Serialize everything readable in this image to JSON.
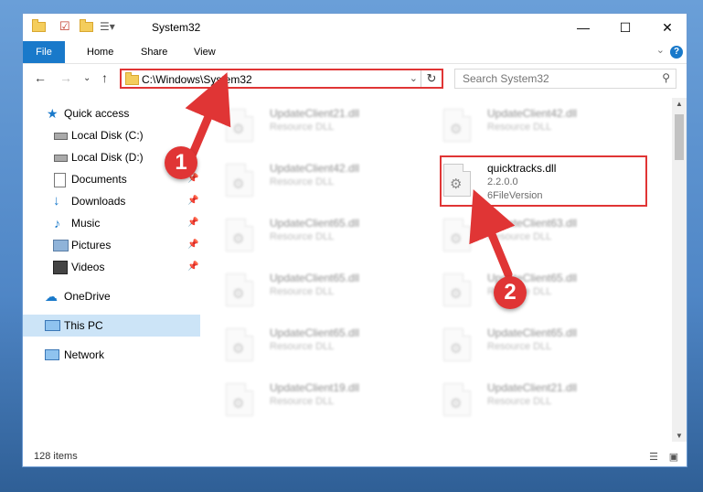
{
  "window": {
    "title": "System32"
  },
  "ribbon": {
    "tabs": [
      {
        "id": "file",
        "label": "File"
      },
      {
        "id": "home",
        "label": "Home"
      },
      {
        "id": "share",
        "label": "Share"
      },
      {
        "id": "view",
        "label": "View"
      }
    ],
    "help_label": "?"
  },
  "address": {
    "path": "C:\\Windows\\System32",
    "search_placeholder": "Search System32"
  },
  "sidebar": {
    "items": [
      {
        "label": "Quick access",
        "icon": "star-icon",
        "pinned": false
      },
      {
        "label": "Local Disk (C:)",
        "icon": "drive-icon",
        "pinned": false
      },
      {
        "label": "Local Disk (D:)",
        "icon": "drive-icon",
        "pinned": false
      },
      {
        "label": "Documents",
        "icon": "documents-icon",
        "pinned": true
      },
      {
        "label": "Downloads",
        "icon": "download-icon",
        "pinned": true
      },
      {
        "label": "Music",
        "icon": "music-icon",
        "pinned": true
      },
      {
        "label": "Pictures",
        "icon": "pictures-icon",
        "pinned": true
      },
      {
        "label": "Videos",
        "icon": "videos-icon",
        "pinned": true
      },
      {
        "label": "OneDrive",
        "icon": "cloud-icon",
        "pinned": false
      },
      {
        "label": "This PC",
        "icon": "computer-icon",
        "pinned": false,
        "selected": true
      },
      {
        "label": "Network",
        "icon": "network-icon",
        "pinned": false
      }
    ]
  },
  "files": [
    {
      "name": "UpdateClient21.dll",
      "meta1": "Resource DLL",
      "meta2": "",
      "blurred": true
    },
    {
      "name": "UpdateClient42.dll",
      "meta1": "Resource DLL",
      "meta2": "",
      "blurred": true
    },
    {
      "name": "UpdateClient42.dll",
      "meta1": "Resource DLL",
      "meta2": "",
      "blurred": true
    },
    {
      "name": "quicktracks.dll",
      "meta1": "2.2.0.0",
      "meta2": "6FileVersion",
      "blurred": false
    },
    {
      "name": "UpdateClient65.dll",
      "meta1": "Resource DLL",
      "meta2": "",
      "blurred": true
    },
    {
      "name": "UpdateClient63.dll",
      "meta1": "Resource DLL",
      "meta2": "",
      "blurred": true
    },
    {
      "name": "UpdateClient65.dll",
      "meta1": "Resource DLL",
      "meta2": "",
      "blurred": true
    },
    {
      "name": "UpdateClient65.dll",
      "meta1": "Resource DLL",
      "meta2": "",
      "blurred": true
    },
    {
      "name": "UpdateClient65.dll",
      "meta1": "Resource DLL",
      "meta2": "",
      "blurred": true
    },
    {
      "name": "UpdateClient65.dll",
      "meta1": "Resource DLL",
      "meta2": "",
      "blurred": true
    },
    {
      "name": "UpdateClient19.dll",
      "meta1": "Resource DLL",
      "meta2": "",
      "blurred": true
    },
    {
      "name": "UpdateClient21.dll",
      "meta1": "Resource DLL",
      "meta2": "",
      "blurred": true
    }
  ],
  "status": {
    "item_count": "128 items"
  },
  "annotations": [
    {
      "number": "1"
    },
    {
      "number": "2"
    }
  ],
  "colors": {
    "accent": "#1979ca",
    "annotation": "#e03535",
    "selected_nav": "#cce4f7"
  }
}
